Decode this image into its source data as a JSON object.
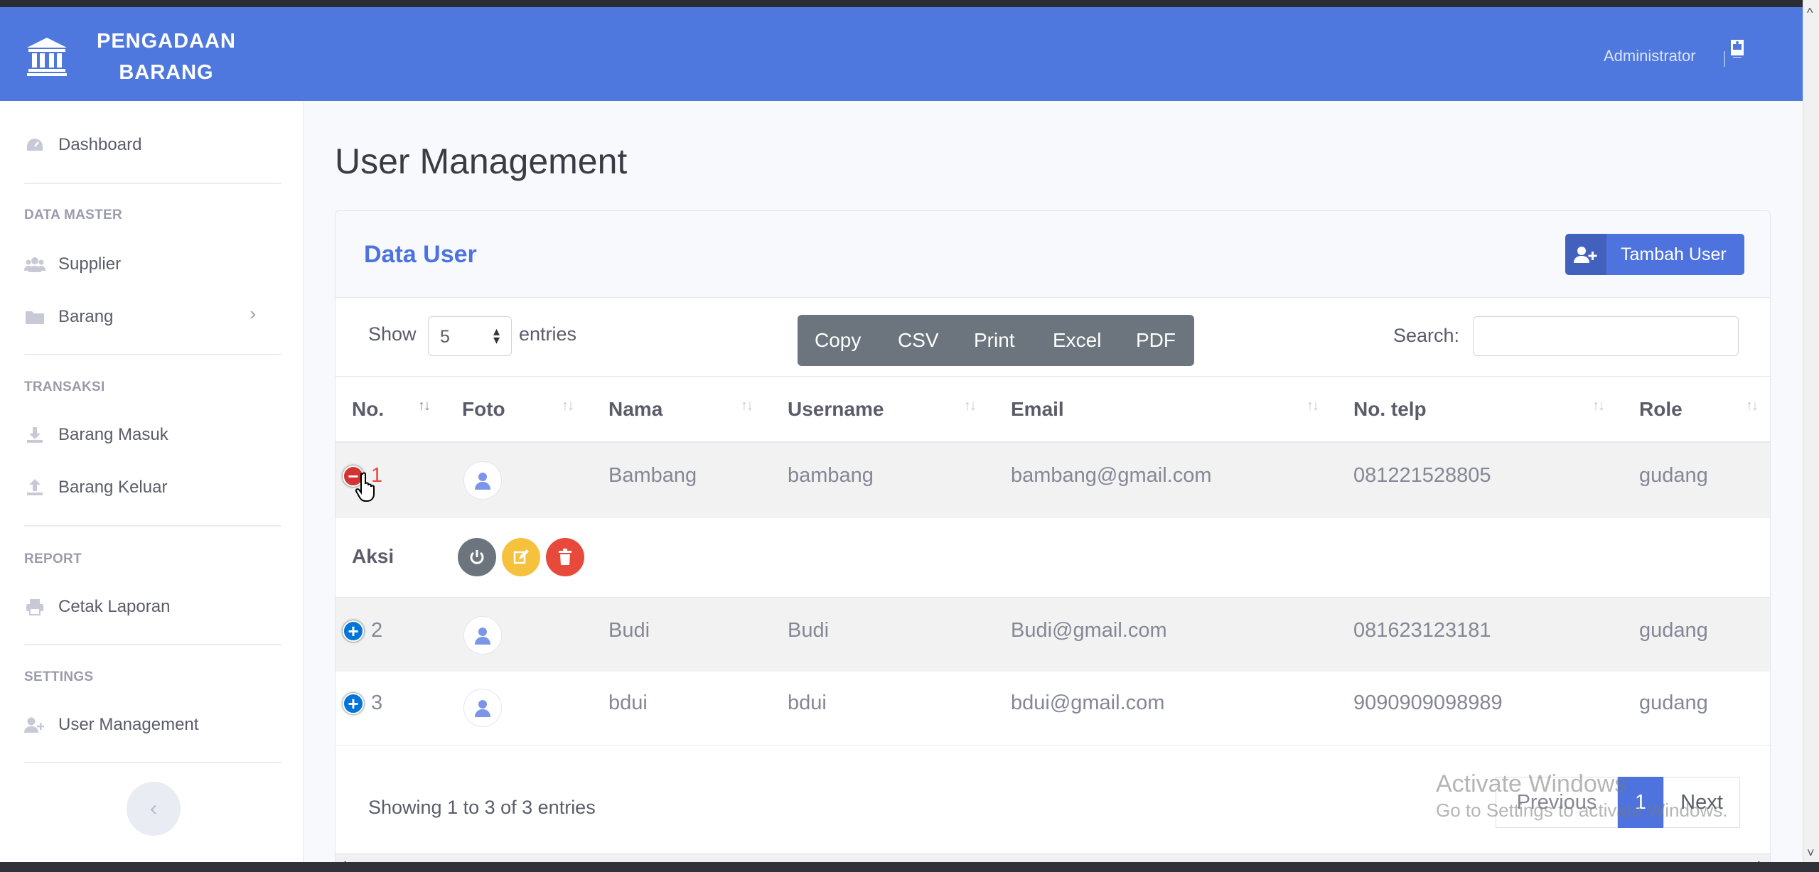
{
  "brand": {
    "line1": "PENGADAAN",
    "line2": "BARANG"
  },
  "topbar": {
    "user_name": "Administrator"
  },
  "sidebar": {
    "dashboard": "Dashboard",
    "section_data_master": "DATA MASTER",
    "supplier": "Supplier",
    "barang": "Barang",
    "section_transaksi": "TRANSAKSI",
    "barang_masuk": "Barang Masuk",
    "barang_keluar": "Barang Keluar",
    "section_report": "REPORT",
    "cetak_laporan": "Cetak Laporan",
    "section_settings": "SETTINGS",
    "user_management": "User Management"
  },
  "page": {
    "title": "User Management"
  },
  "card": {
    "title": "Data User",
    "add_button": "Tambah User",
    "show_label": "Show",
    "page_length": "5",
    "entries_label": "entries",
    "export_buttons": [
      "Copy",
      "CSV",
      "Print",
      "Excel",
      "PDF"
    ],
    "search_label": "Search:",
    "search_value": ""
  },
  "table": {
    "columns": [
      "No.",
      "Foto",
      "Nama",
      "Username",
      "Email",
      "No. telp",
      "Role"
    ],
    "rows": [
      {
        "no": "1",
        "nama": "Bambang",
        "username": "bambang",
        "email": "bambang@gmail.com",
        "telp": "081221528805",
        "role": "gudang",
        "expanded": true
      },
      {
        "no": "2",
        "nama": "Budi",
        "username": "Budi",
        "email": "Budi@gmail.com",
        "telp": "081623123181",
        "role": "gudang",
        "expanded": false
      },
      {
        "no": "3",
        "nama": "bdui",
        "username": "bdui",
        "email": "bdui@gmail.com",
        "telp": "9090909098989",
        "role": "gudang",
        "expanded": false
      }
    ],
    "child_row_label": "Aksi"
  },
  "footer": {
    "info": "Showing 1 to 3 of 3 entries",
    "previous": "Previous",
    "current_page": "1",
    "next": "Next"
  },
  "watermark": {
    "line1": "Activate Windows",
    "line2": "Go to Settings to activate Windows."
  },
  "colors": {
    "primary": "#4e73df",
    "topbar": "#4e78dd",
    "danger": "#e74a3b",
    "warning": "#f6c23e",
    "secondary": "#6c757d"
  },
  "icons": [
    "bank-icon",
    "user-avatar-icon",
    "dashboard-icon",
    "users-icon",
    "folder-icon",
    "chevron-right-icon",
    "download-icon",
    "upload-icon",
    "print-icon",
    "user-plus-icon",
    "chevron-left-icon",
    "power-icon",
    "edit-icon",
    "trash-icon",
    "hand-cursor-icon"
  ]
}
